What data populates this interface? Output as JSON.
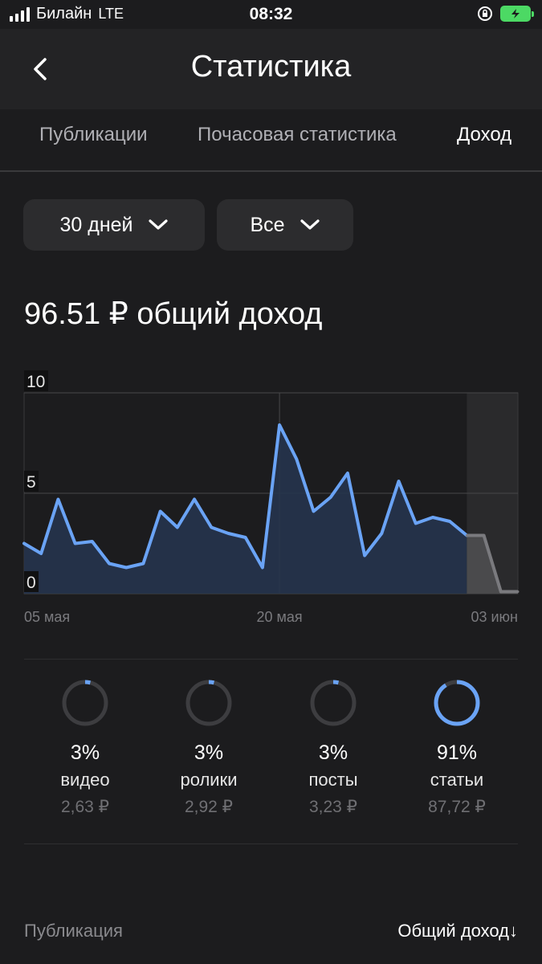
{
  "status_bar": {
    "carrier": "Билайн",
    "network": "LTE",
    "time": "08:32"
  },
  "header": {
    "title": "Статистика"
  },
  "tabs": [
    {
      "label": "Публикации",
      "active": false
    },
    {
      "label": "Почасовая статистика",
      "active": false
    },
    {
      "label": "Доход",
      "active": true
    }
  ],
  "filters": {
    "period": "30 дней",
    "type": "Все"
  },
  "summary": {
    "total": "96.51 ₽ общий доход"
  },
  "chart_data": {
    "type": "area",
    "x_tick_labels": [
      "05 мая",
      "20 мая",
      "03 июн"
    ],
    "y_tick_labels": [
      "10",
      "5",
      "0"
    ],
    "ylim": [
      0,
      10
    ],
    "y_ticks": [
      0,
      5,
      10
    ],
    "series": [
      {
        "values": [
          2.5,
          2.0,
          4.7,
          2.5,
          2.6,
          1.5,
          1.3,
          1.5,
          4.1,
          3.3,
          4.7,
          3.3,
          3.0,
          2.8,
          1.3,
          8.4,
          6.7,
          4.1,
          4.8,
          6.0,
          1.9,
          3.0,
          5.6,
          3.5,
          3.8,
          3.6,
          2.9,
          2.9,
          0.1,
          0.1
        ],
        "color": "#6aa3f5"
      }
    ],
    "x_tick_index": [
      0,
      15,
      29
    ],
    "highlight_last_points": 4,
    "grid": true
  },
  "breakdown": [
    {
      "percent": "3%",
      "label": "видео",
      "amount": "2,63 ₽",
      "fraction": 0.03,
      "color": "#6aa3f5"
    },
    {
      "percent": "3%",
      "label": "ролики",
      "amount": "2,92 ₽",
      "fraction": 0.03,
      "color": "#6aa3f5"
    },
    {
      "percent": "3%",
      "label": "посты",
      "amount": "3,23 ₽",
      "fraction": 0.03,
      "color": "#6aa3f5"
    },
    {
      "percent": "91%",
      "label": "статьи",
      "amount": "87,72 ₽",
      "fraction": 0.91,
      "color": "#6aa3f5"
    }
  ],
  "footer": {
    "left": "Публикация",
    "right": "Общий доход↓"
  }
}
